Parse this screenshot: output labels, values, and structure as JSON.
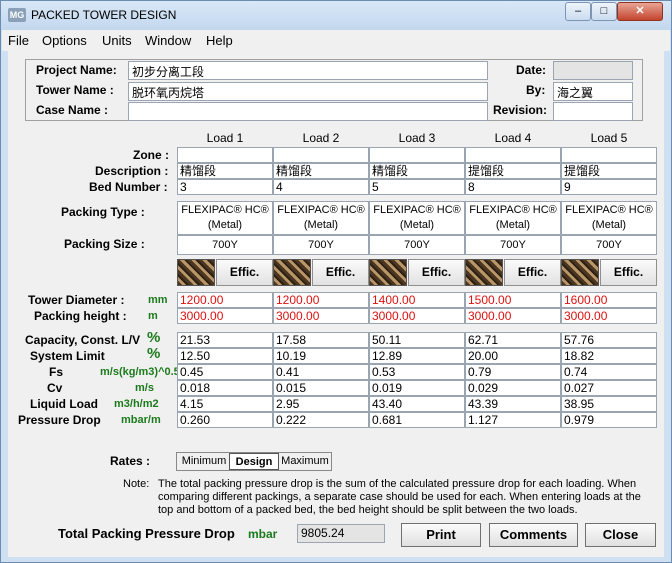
{
  "window": {
    "logo": "MG",
    "title": "PACKED TOWER DESIGN",
    "min_glyph": "–",
    "max_glyph": "□",
    "close_glyph": "✕"
  },
  "menu": [
    "File",
    "Options",
    "Units",
    "Window",
    "Help"
  ],
  "project": {
    "project_name_label": "Project Name:",
    "project_name": "初步分离工段",
    "tower_name_label": "Tower Name :",
    "tower_name": "脱环氧丙烷塔",
    "case_name_label": "Case Name :",
    "case_name": "",
    "date_label": "Date:",
    "date": "",
    "by_label": "By:",
    "by": "海之翼",
    "revision_label": "Revision:",
    "revision": ""
  },
  "loads": {
    "headers": [
      "Load 1",
      "Load 2",
      "Load 3",
      "Load 4",
      "Load 5"
    ],
    "zone_label": "Zone :",
    "zone": [
      "",
      "",
      "",
      "",
      ""
    ],
    "description_label": "Description :",
    "description": [
      "精馏段",
      "精馏段",
      "精馏段",
      "提馏段",
      "提馏段"
    ],
    "bed_number_label": "Bed Number :",
    "bed_number": [
      "3",
      "4",
      "5",
      "8",
      "9"
    ],
    "packing_type_label": "Packing Type :",
    "packing_type": [
      [
        "FLEXIPAC® HC®",
        "(Metal)"
      ],
      [
        "FLEXIPAC® HC®",
        "(Metal)"
      ],
      [
        "FLEXIPAC® HC®",
        "(Metal)"
      ],
      [
        "FLEXIPAC® HC®",
        "(Metal)"
      ],
      [
        "FLEXIPAC® HC®",
        "(Metal)"
      ]
    ],
    "packing_size_label": "Packing Size :",
    "packing_size": [
      "700Y",
      "700Y",
      "700Y",
      "700Y",
      "700Y"
    ],
    "effic_label": "Effic.",
    "tower_diameter_label": "Tower Diameter :",
    "tower_diameter_unit": "mm",
    "tower_diameter": [
      "1200.00",
      "1200.00",
      "1400.00",
      "1500.00",
      "1600.00"
    ],
    "packing_height_label": "Packing height :",
    "packing_height_unit": "m",
    "packing_height": [
      "3000.00",
      "3000.00",
      "3000.00",
      "3000.00",
      "3000.00"
    ],
    "capacity_label": "Capacity, Const. L/V",
    "capacity_unit": "%",
    "capacity": [
      "21.53",
      "17.58",
      "50.11",
      "62.71",
      "57.76"
    ],
    "system_limit_label": "System Limit",
    "system_limit_unit": "%",
    "system_limit": [
      "12.50",
      "10.19",
      "12.89",
      "20.00",
      "18.82"
    ],
    "fs_label": "Fs",
    "fs_unit": "m/s(kg/m3)^0.5",
    "fs": [
      "0.45",
      "0.41",
      "0.53",
      "0.79",
      "0.74"
    ],
    "cv_label": "Cv",
    "cv_unit": "m/s",
    "cv": [
      "0.018",
      "0.015",
      "0.019",
      "0.029",
      "0.027"
    ],
    "liquid_load_label": "Liquid Load",
    "liquid_load_unit": "m3/h/m2",
    "liquid_load": [
      "4.15",
      "2.95",
      "43.40",
      "43.39",
      "38.95"
    ],
    "pressure_drop_label": "Pressure Drop",
    "pressure_drop_unit": "mbar/m",
    "pressure_drop": [
      "0.260",
      "0.222",
      "0.681",
      "1.127",
      "0.979"
    ]
  },
  "rates": {
    "label": "Rates :",
    "options": [
      "Minimum",
      "Design",
      "Maximum"
    ],
    "selected": "Design"
  },
  "note": {
    "label": "Note:",
    "text": "The total packing pressure drop is the sum of the calculated pressure drop for each loading.  When comparing different packings, a separate case should be used for each.  When entering loads at the top and bottom of a packed bed, the bed height should be split between the two loads."
  },
  "total": {
    "label": "Total Packing Pressure Drop",
    "unit": "mbar",
    "value": "9805.24"
  },
  "buttons": {
    "print": "Print",
    "comments": "Comments",
    "close": "Close"
  }
}
